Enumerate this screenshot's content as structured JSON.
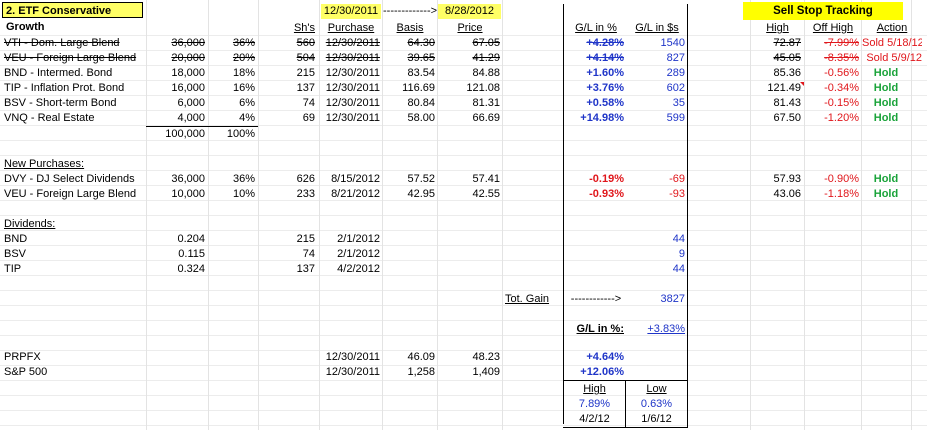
{
  "title": "2. ETF Conservative Growth",
  "header": {
    "date_start": "12/30/2011",
    "arrow": "------------->",
    "date_end": "8/28/2012",
    "shs": "Sh's",
    "purchase": "Purchase",
    "basis": "Basis",
    "price": "Price",
    "gl_pct": "G/L in %",
    "gl_usd": "G/L in $s",
    "sst_title": "Sell Stop Tracking",
    "high": "High",
    "off_high": "Off High",
    "action": "Action"
  },
  "holdings": [
    {
      "name": "VTI - Dom. Large Blend",
      "amount": "36,000",
      "pct": "36%",
      "shs": "560",
      "purchase": "12/30/2011",
      "basis": "64.30",
      "price": "67.05",
      "gl_pct": "+4.28%",
      "gl_usd": "1540",
      "high": "72.87",
      "off_high": "-7.99%",
      "action": "Sold 5/18/12"
    },
    {
      "name": "VEU - Foreign Large Blend",
      "amount": "20,000",
      "pct": "20%",
      "shs": "504",
      "purchase": "12/30/2011",
      "basis": "39.65",
      "price": "41.29",
      "gl_pct": "+4.14%",
      "gl_usd": "827",
      "high": "45.05",
      "off_high": "-8.35%",
      "action": "Sold 5/9/12"
    },
    {
      "name": "BND - Intermed. Bond",
      "amount": "18,000",
      "pct": "18%",
      "shs": "215",
      "purchase": "12/30/2011",
      "basis": "83.54",
      "price": "84.88",
      "gl_pct": "+1.60%",
      "gl_usd": "289",
      "high": "85.36",
      "off_high": "-0.56%",
      "action": "Hold"
    },
    {
      "name": "TIP - Inflation Prot. Bond",
      "amount": "16,000",
      "pct": "16%",
      "shs": "137",
      "purchase": "12/30/2011",
      "basis": "116.69",
      "price": "121.08",
      "gl_pct": "+3.76%",
      "gl_usd": "602",
      "high": "121.49",
      "off_high": "-0.34%",
      "action": "Hold"
    },
    {
      "name": "BSV - Short-term Bond",
      "amount": "6,000",
      "pct": "6%",
      "shs": "74",
      "purchase": "12/30/2011",
      "basis": "80.84",
      "price": "81.31",
      "gl_pct": "+0.58%",
      "gl_usd": "35",
      "high": "81.43",
      "off_high": "-0.15%",
      "action": "Hold"
    },
    {
      "name": "VNQ - Real Estate",
      "amount": "4,000",
      "pct": "4%",
      "shs": "69",
      "purchase": "12/30/2011",
      "basis": "58.00",
      "price": "66.69",
      "gl_pct": "+14.98%",
      "gl_usd": "599",
      "high": "67.50",
      "off_high": "-1.20%",
      "action": "Hold"
    }
  ],
  "totals": {
    "amount": "100,000",
    "pct": "100%"
  },
  "new_purchases_label": "New Purchases:",
  "new_purchases": [
    {
      "name": "DVY - DJ Select Dividends",
      "amount": "36,000",
      "pct": "36%",
      "shs": "626",
      "purchase": "8/15/2012",
      "basis": "57.52",
      "price": "57.41",
      "gl_pct": "-0.19%",
      "gl_usd": "-69",
      "high": "57.93",
      "off_high": "-0.90%",
      "action": "Hold"
    },
    {
      "name": "VEU - Foreign Large Blend",
      "amount": "10,000",
      "pct": "10%",
      "shs": "233",
      "purchase": "8/21/2012",
      "basis": "42.95",
      "price": "42.55",
      "gl_pct": "-0.93%",
      "gl_usd": "-93",
      "high": "43.06",
      "off_high": "-1.18%",
      "action": "Hold"
    }
  ],
  "dividends_label": "Dividends:",
  "dividends": [
    {
      "name": "BND",
      "amount": "0.204",
      "shs": "215",
      "date": "2/1/2012",
      "gl_usd": "44"
    },
    {
      "name": "BSV",
      "amount": "0.115",
      "shs": "74",
      "date": "2/1/2012",
      "gl_usd": "9"
    },
    {
      "name": "TIP",
      "amount": "0.324",
      "shs": "137",
      "date": "4/2/2012",
      "gl_usd": "44"
    }
  ],
  "total_gain": {
    "label": "Tot. Gain",
    "arrow": "------------>",
    "value": "3827"
  },
  "gl_summary": {
    "label": "G/L in %:",
    "value": "+3.83%"
  },
  "benchmarks": [
    {
      "name": "PRPFX",
      "date": "12/30/2011",
      "basis": "46.09",
      "price": "48.23",
      "gl_pct": "+4.64%"
    },
    {
      "name": "S&P 500",
      "date": "12/30/2011",
      "basis": "1,258",
      "price": "1,409",
      "gl_pct": "+12.06%"
    }
  ],
  "high_low": {
    "high_label": "High",
    "low_label": "Low",
    "high_pct": "7.89%",
    "low_pct": "0.63%",
    "high_date": "4/2/12",
    "low_date": "1/6/12"
  },
  "colors": {
    "yellow": "#ffff66",
    "blue": "#1f35c8",
    "red": "#e0161b",
    "green": "#1aa33a"
  }
}
